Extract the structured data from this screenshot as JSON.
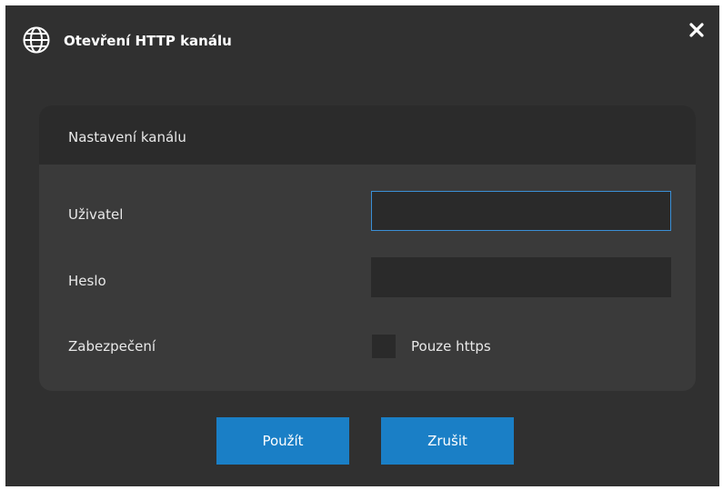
{
  "dialog": {
    "title": "Otevření HTTP kanálu",
    "icons": {
      "title_icon": "globe-icon",
      "close_icon": "close-icon"
    },
    "colors": {
      "background": "#303030",
      "accent": "#1a7fc6",
      "focus_border": "#3a8fd6"
    }
  },
  "panel": {
    "header": "Nastavení kanálu",
    "user": {
      "label": "Uživatel",
      "value": ""
    },
    "password": {
      "label": "Heslo",
      "value": ""
    },
    "security": {
      "label": "Zabezpečení",
      "checkbox_label": "Pouze https",
      "checked": false
    }
  },
  "buttons": {
    "apply": "Použít",
    "cancel": "Zrušit"
  }
}
